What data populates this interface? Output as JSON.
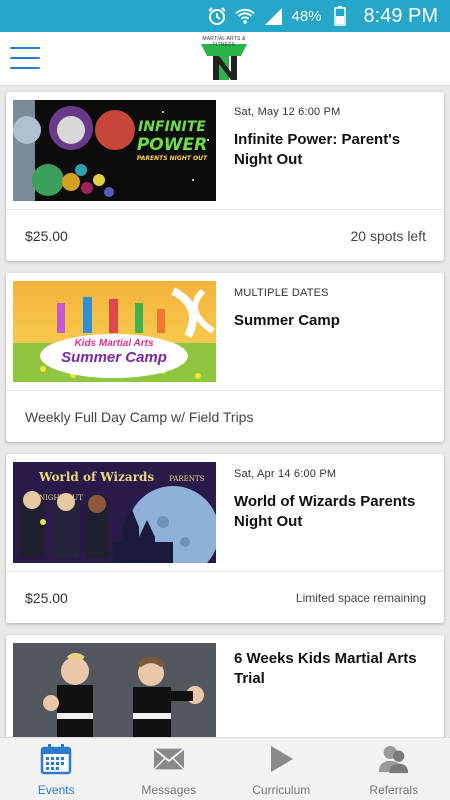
{
  "status_bar": {
    "battery_pct": "48%",
    "clock": "8:49 PM",
    "icons": [
      "alarm-icon",
      "wifi-icon",
      "signal-icon",
      "battery-icon"
    ]
  },
  "app_bar": {
    "logo_text": "MARTIAL ARTS & FITNESS",
    "menu_icon": "hamburger-menu-icon"
  },
  "events": [
    {
      "date": "Sat, May 12 6:00 PM",
      "title": "Infinite Power: Parent's Night Out",
      "image_text": [
        "INFINITE",
        "POWER",
        "PARENTS NIGHT OUT"
      ],
      "price": "$25.00",
      "status": "20 spots left"
    },
    {
      "date": "MULTIPLE DATES",
      "title": "Summer Camp",
      "image_text": [
        "Kids Martial Arts",
        "Summer Camp"
      ],
      "description": "Weekly Full Day Camp w/ Field Trips"
    },
    {
      "date": "Sat, Apr 14 6:00 PM",
      "title": "World of Wizards Parents Night Out",
      "image_text": [
        "World of Wizards",
        "PARENTS NIGHT OUT"
      ],
      "price": "$25.00",
      "status": "Limited space remaining"
    },
    {
      "date": "",
      "title": "6 Weeks Kids Martial Arts Trial"
    }
  ],
  "bottom_nav": [
    {
      "label": "Events",
      "icon": "calendar-icon",
      "active": true
    },
    {
      "label": "Messages",
      "icon": "envelope-icon",
      "active": false
    },
    {
      "label": "Curriculum",
      "icon": "play-icon",
      "active": false
    },
    {
      "label": "Referrals",
      "icon": "people-icon",
      "active": false
    }
  ],
  "colors": {
    "status_bar": "#26a6c9",
    "accent": "#2a7ad0",
    "logo_green": "#2bb34a"
  }
}
